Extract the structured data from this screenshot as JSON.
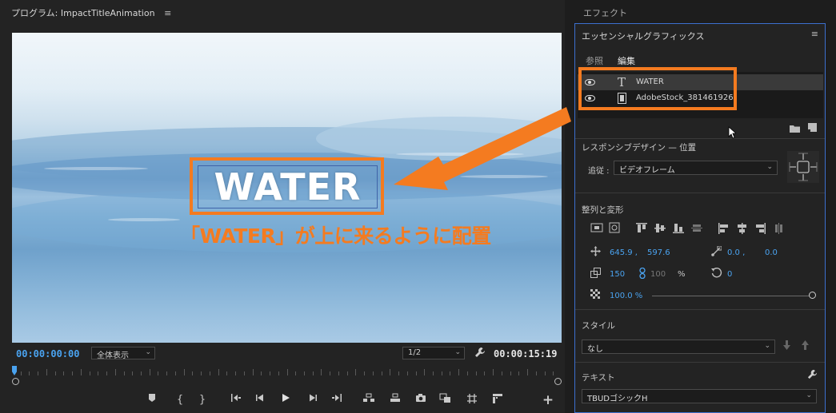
{
  "program_monitor": {
    "tab_label": "プログラム: ImpactTitleAnimation",
    "menu_glyph": "≡",
    "title_text": "WATER",
    "annotation_caption": "「WATER」が上に来るように配置",
    "current_timecode": "00:00:00:00",
    "zoom_select": "全体表示",
    "resolution_select": "1/2",
    "duration_timecode": "00:00:15:19",
    "playhead_fraction": 0.0
  },
  "effects_panel": {
    "tab_label": "エフェクト"
  },
  "essential_graphics": {
    "tab_label": "エッセンシャルグラフィックス",
    "menu_glyph": "≡",
    "tabs": [
      "参照",
      "編集"
    ],
    "active_tab": "編集",
    "layers": [
      {
        "name": "WATER",
        "type": "text",
        "selected": true
      },
      {
        "name": "AdobeStock_381461926",
        "type": "video",
        "selected": false
      }
    ],
    "responsive": {
      "title": "レスポンシブデザイン — 位置",
      "follow_label": "追従 :",
      "follow_value": "ビデオフレーム"
    },
    "align_transform": {
      "title": "整列と変形",
      "position_x": "645.9 ,",
      "position_y": "597.6",
      "anchor_x": "0.0 ,",
      "anchor_y": "0.0",
      "scale": "150",
      "scale_linked": "100",
      "percent": "%",
      "rotation": "0",
      "opacity": "100.0 %",
      "opacity_fraction": 1.0
    },
    "style": {
      "title": "スタイル",
      "value": "なし"
    },
    "text": {
      "title": "テキスト",
      "font": "TBUDゴシックH"
    }
  },
  "colors": {
    "accent_blue": "#4aa3f0",
    "highlight_orange": "#f47b20",
    "panel_border": "#3c6fcf"
  }
}
